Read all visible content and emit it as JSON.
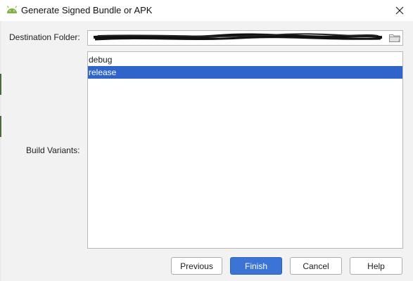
{
  "window": {
    "title": "Generate Signed Bundle or APK",
    "icon": "android-icon",
    "close_icon": "close-icon"
  },
  "destination": {
    "label": "Destination Folder:",
    "value": "",
    "value_redacted": true,
    "browse_icon": "folder-icon"
  },
  "build_variants": {
    "label": "Build Variants:",
    "items": [
      {
        "label": "debug",
        "selected": false
      },
      {
        "label": "release",
        "selected": true
      }
    ]
  },
  "buttons": {
    "previous": "Previous",
    "finish": "Finish",
    "cancel": "Cancel",
    "help": "Help"
  },
  "colors": {
    "selection": "#2f65ca",
    "primary_button": "#3b74d4",
    "android_green": "#7cb342"
  }
}
